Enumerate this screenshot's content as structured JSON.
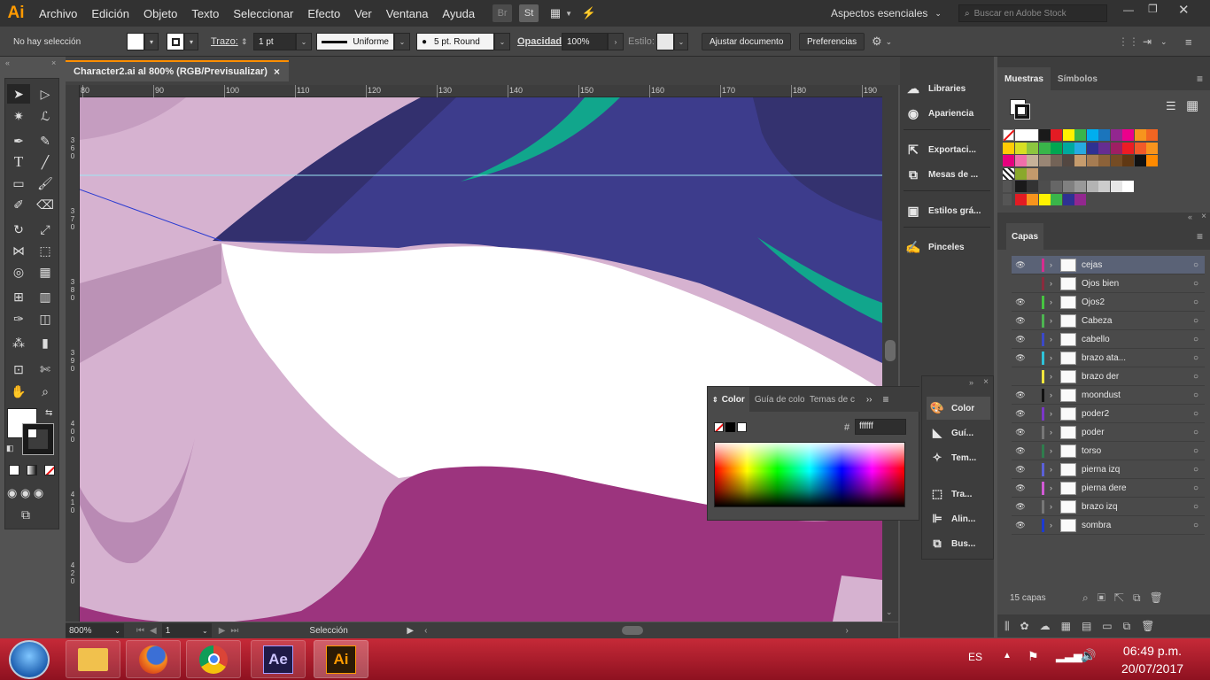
{
  "app": {
    "logo": "Ai"
  },
  "menu": [
    "Archivo",
    "Edición",
    "Objeto",
    "Texto",
    "Seleccionar",
    "Efecto",
    "Ver",
    "Ventana",
    "Ayuda"
  ],
  "menu_extras": {
    "br": "Br",
    "st": "St"
  },
  "workspace": "Aspectos esenciales",
  "search_placeholder": "Buscar en Adobe Stock",
  "control": {
    "selection": "No hay selección",
    "stroke_label": "Trazo:",
    "stroke_value": "1 pt",
    "profile": "Uniforme",
    "brush": "5 pt. Round",
    "opacity_label": "Opacidad:",
    "opacity_value": "100%",
    "style_label": "Estilo:",
    "doc_setup": "Ajustar documento",
    "prefs": "Preferencias"
  },
  "document": {
    "tab": "Character2.ai al 800% (RGB/Previsualizar)",
    "close": "×"
  },
  "ruler_top": [
    "80",
    "90",
    "100",
    "110",
    "120",
    "130",
    "140",
    "150",
    "160",
    "170",
    "180",
    "190"
  ],
  "ruler_left": [
    {
      "digits": [
        "3",
        "6",
        "0"
      ]
    },
    {
      "digits": [
        "3",
        "7",
        "0"
      ]
    },
    {
      "digits": [
        "3",
        "8",
        "0"
      ]
    },
    {
      "digits": [
        "3",
        "9",
        "0"
      ]
    },
    {
      "digits": [
        "4",
        "0",
        "0"
      ]
    },
    {
      "digits": [
        "4",
        "1",
        "0"
      ]
    },
    {
      "digits": [
        "4",
        "2",
        "0"
      ]
    }
  ],
  "status": {
    "zoom": "800%",
    "artboard": "1",
    "tool": "Selección"
  },
  "dock": [
    {
      "name": "libraries",
      "label": "Libraries",
      "icon": "libraries-icon"
    },
    {
      "name": "appearance",
      "label": "Apariencia",
      "icon": "appearance-icon"
    },
    {
      "name": "export",
      "label": "Exportaci...",
      "icon": "export-icon"
    },
    {
      "name": "artboards",
      "label": "Mesas de ...",
      "icon": "artboards-icon"
    },
    {
      "name": "graphic-styles",
      "label": "Estilos grá...",
      "icon": "graphic-styles-icon"
    },
    {
      "name": "brushes",
      "label": "Pinceles",
      "icon": "brushes-icon"
    }
  ],
  "colordock": [
    {
      "name": "color",
      "label": "Color"
    },
    {
      "name": "guide",
      "label": "Guí..."
    },
    {
      "name": "themes",
      "label": "Tem..."
    },
    {
      "name": "transform",
      "label": "Tra..."
    },
    {
      "name": "align",
      "label": "Alin..."
    },
    {
      "name": "pathfinder",
      "label": "Bus..."
    }
  ],
  "color_panel": {
    "tabs": [
      "Color",
      "Guía de colo",
      "Temas de c"
    ],
    "hex_label": "#",
    "hex_value": "ffffff",
    "more": "››"
  },
  "swatch_panel": {
    "tabs": [
      "Muestras",
      "Símbolos"
    ]
  },
  "layers_panel": {
    "tab": "Capas",
    "count": "15 capas",
    "layers": [
      {
        "name": "cejas",
        "color": "#d52d8e",
        "visible": true,
        "selected": true
      },
      {
        "name": "Ojos bien",
        "color": "#8a2b3e",
        "visible": false
      },
      {
        "name": "Ojos2",
        "color": "#46c441",
        "visible": true
      },
      {
        "name": "Cabeza",
        "color": "#4db551",
        "visible": true
      },
      {
        "name": "cabello",
        "color": "#3b48c8",
        "visible": true
      },
      {
        "name": "brazo ata...",
        "color": "#2fc3d9",
        "visible": true
      },
      {
        "name": "brazo der",
        "color": "#f2e63d",
        "visible": false
      },
      {
        "name": "moondust",
        "color": "#121212",
        "visible": true
      },
      {
        "name": "poder2",
        "color": "#7b36c9",
        "visible": true
      },
      {
        "name": "poder",
        "color": "#777777",
        "visible": true
      },
      {
        "name": "torso",
        "color": "#2f7d4d",
        "visible": true
      },
      {
        "name": "pierna izq",
        "color": "#5b60d8",
        "visible": true
      },
      {
        "name": "pierna dere",
        "color": "#d25ad6",
        "visible": true
      },
      {
        "name": "brazo izq",
        "color": "#777777",
        "visible": true
      },
      {
        "name": "sombra",
        "color": "#1c3ad1",
        "visible": true
      }
    ]
  },
  "taskbar": {
    "lang": "ES",
    "time": "06:49 p.m.",
    "date": "20/07/2017",
    "ae": "Ae",
    "ai": "Ai"
  },
  "colors": {
    "accent": "#ff9a00",
    "canvas_purple": "#3d3c8c",
    "canvas_pink": "#d6b2d0",
    "teal": "#11a68c",
    "magenta": "#9c347e"
  }
}
